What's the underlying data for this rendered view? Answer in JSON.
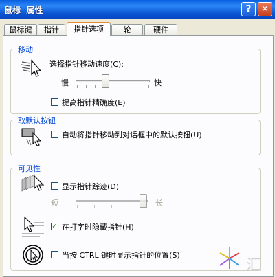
{
  "window": {
    "title": "鼠标  属性",
    "help_label": "?",
    "close_label": "✕"
  },
  "tabs": [
    {
      "label": "鼠标键"
    },
    {
      "label": "指针"
    },
    {
      "label": "指针选项",
      "active": true
    },
    {
      "label": "轮"
    },
    {
      "label": "硬件"
    }
  ],
  "motion": {
    "title": "移动",
    "speed_label": "选择指针移动速度(C):",
    "slow_label": "慢",
    "fast_label": "快",
    "speed_level": 0.5,
    "precision_label": "提高指针精确度(E)",
    "precision_checked": false
  },
  "snap": {
    "title": "取默认按钮",
    "snap_label": "自动将指针移动到对话框中的默认按钮(U)",
    "snap_checked": false
  },
  "visibility": {
    "title": "可见性",
    "trails_label": "显示指针踪迹(D)",
    "trails_checked": false,
    "short_label": "短",
    "long_label": "长",
    "trail_level": 1.0,
    "hide_label": "在打字时隐藏指针(H)",
    "hide_checked": true,
    "ctrl_label": "当按 CTRL 键时显示指针的位置(S)",
    "ctrl_checked": false
  },
  "icons": {
    "speed": "pointer-speed-icon",
    "snap": "snap-to-button-icon",
    "trails": "pointer-trails-icon",
    "hide": "hide-pointer-icon",
    "ctrl": "pointer-location-icon"
  },
  "watermark": {
    "text": "汇"
  }
}
